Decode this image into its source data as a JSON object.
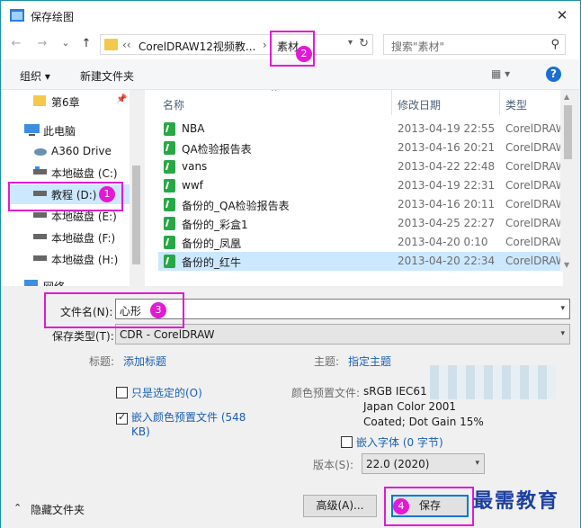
{
  "window": {
    "title": "保存绘图"
  },
  "nav": {
    "back": "←",
    "forward": "→",
    "recent": "⌄",
    "up": "↑"
  },
  "address": {
    "prefix": "‹‹",
    "seg1": "CorelDRAW12视频教...",
    "sep": "›",
    "seg2": "素材",
    "refresh": "↻"
  },
  "search": {
    "placeholder": "搜索\"素材\""
  },
  "toolbar": {
    "organize": "组织 ▾",
    "new_folder": "新建文件夹",
    "view": "▦ ▾",
    "help": "?"
  },
  "sidebar": {
    "items": [
      {
        "label": "第6章",
        "icon": "folder-icon"
      },
      {
        "label": "此电脑",
        "icon": "computer-icon"
      },
      {
        "label": "A360 Drive",
        "icon": "cloud-icon"
      },
      {
        "label": "本地磁盘 (C:)",
        "icon": "drive-icon"
      },
      {
        "label": "教程 (D:)",
        "icon": "drive-icon"
      },
      {
        "label": "本地磁盘 (E:)",
        "icon": "drive-icon"
      },
      {
        "label": "本地磁盘 (F:)",
        "icon": "drive-icon"
      },
      {
        "label": "本地磁盘 (H:)",
        "icon": "drive-icon"
      },
      {
        "label": "网络",
        "icon": "network-icon"
      }
    ]
  },
  "filelist": {
    "columns": {
      "name": "名称",
      "date": "修改日期",
      "type": "类型"
    },
    "rows": [
      {
        "name": "NBA",
        "date": "2013-04-19 22:55",
        "type": "CorelDRAW"
      },
      {
        "name": "QA检验报告表",
        "date": "2013-04-16 20:21",
        "type": "CorelDRAW"
      },
      {
        "name": "vans",
        "date": "2013-04-22 22:48",
        "type": "CorelDRAW"
      },
      {
        "name": "wwf",
        "date": "2013-04-19 22:31",
        "type": "CorelDRAW"
      },
      {
        "name": "备份的_QA检验报告表",
        "date": "2013-04-16 20:11",
        "type": "CorelDRAW"
      },
      {
        "name": "备份的_彩盒1",
        "date": "2013-04-25 22:27",
        "type": "CorelDRAW"
      },
      {
        "name": "备份的_凤凰",
        "date": "2013-04-20 0:10",
        "type": "CorelDRAW"
      },
      {
        "name": "备份的_红牛",
        "date": "2013-04-20 22:34",
        "type": "CorelDRAW"
      }
    ]
  },
  "form": {
    "filename_label": "文件名(N):",
    "filename_value": "心形",
    "filetype_label": "保存类型(T):",
    "filetype_value": "CDR - CorelDRAW",
    "title_label": "标题:",
    "title_link": "添加标题",
    "subject_label": "主题:",
    "subject_link": "指定主题",
    "selected_only": "只是选定的(O)",
    "embed_profile": "嵌入颜色预置文件 (548 KB)",
    "profile_label": "颜色预置文件:",
    "profile_lines": [
      "sRGB IEC61",
      "Japan Color 2001",
      "Coated; Dot Gain 15%"
    ],
    "embed_fonts": "嵌入字体 (0 字节)",
    "version_label": "版本(S):",
    "version_value": "22.0 (2020)",
    "hide_folders": "隐藏文件夹",
    "advanced": "高级(A)...",
    "save": "保存"
  },
  "annotations": {
    "b1": "1",
    "b2": "2",
    "b3": "3",
    "b4": "4"
  },
  "watermark": "最需教育",
  "colors": {
    "highlight": "#e21ad6",
    "selection": "#cce8ff",
    "link": "#1a5fb4"
  }
}
